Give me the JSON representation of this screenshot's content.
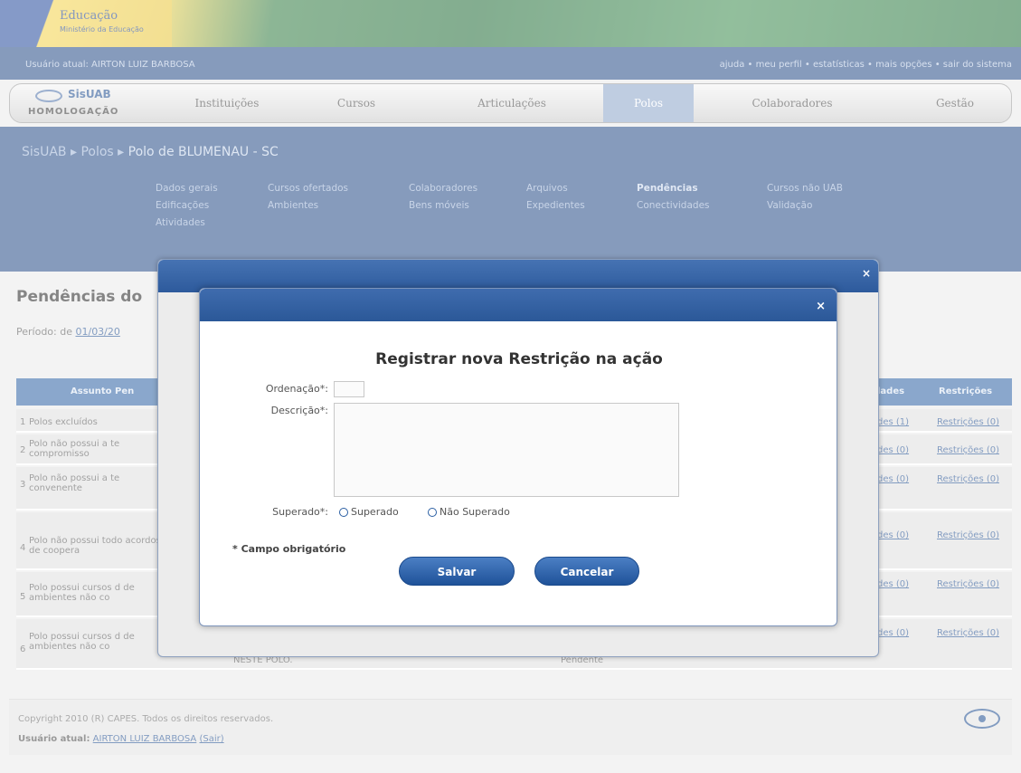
{
  "banner": {
    "title": "Educação",
    "subtitle": "Ministério da Educação"
  },
  "topbar": {
    "user": "Usuário atual: AIRTON LUIZ BARBOSA",
    "links": "ajuda • meu perfil • estatísticas • mais opções • sair do sistema"
  },
  "nav": {
    "brand_top": "SisUAB",
    "brand_bottom": "HOMOLOGAÇÃO",
    "items": [
      "Instituições",
      "Cursos",
      "Articulações",
      "Polos",
      "Colaboradores",
      "Gestão"
    ],
    "active": "Polos"
  },
  "breadcrumb": {
    "root": "SisUAB",
    "section": "Polos",
    "current": "Polo de BLUMENAU - SC",
    "sep": "▸"
  },
  "subnav": {
    "col1": [
      "Dados gerais",
      "Edificações",
      "Atividades"
    ],
    "col2": [
      "Cursos ofertados",
      "Ambientes"
    ],
    "col3": [
      "Colaboradores",
      "Bens móveis"
    ],
    "col4": [
      "Arquivos",
      "Expedientes"
    ],
    "col5": [
      "Pendências",
      "Conectividades"
    ],
    "col6": [
      "Cursos não UAB",
      "Validação"
    ]
  },
  "page": {
    "title": "Pendências do",
    "period_label": "Período: de",
    "period_value": "01/03/20",
    "table": {
      "headers": [
        "Assunto Pen",
        "lades",
        "Restrições"
      ],
      "rows": [
        {
          "n": "1",
          "text": "Polos excluídos",
          "a": "des (1)",
          "b": "Restrições (0)"
        },
        {
          "n": "2",
          "text": "Polo não possui a te compromisso",
          "a": "des (0)",
          "b": "Restrições (0)"
        },
        {
          "n": "3",
          "text": "Polo não possui a te convenente",
          "a": "des (0)",
          "b": "Restrições (0)"
        },
        {
          "n": "4",
          "text": "Polo não possui todo acordos de coopera",
          "a": "des (0)",
          "b": "Restrições (0)"
        },
        {
          "n": "5",
          "text": "Polo possui cursos d de ambientes não co",
          "a": "des (0)",
          "b": "Restrições (0)"
        },
        {
          "n": "6",
          "text": "Polo possui cursos d de ambientes não co",
          "a": "des (0)",
          "b": "Restrições (0)"
        }
      ],
      "under_text_1": "NESTE POLO.",
      "under_text_2": "Pendente"
    }
  },
  "footer": {
    "copyright": "Copyright 2010 (R) CAPES. Todos os direitos reservados.",
    "user_label": "Usuário atual:",
    "user_name": "AIRTON LUIZ BARBOSA",
    "exit": "(Sair)"
  },
  "dialog": {
    "close": "×",
    "title": "Registrar nova Restrição na ação",
    "ordenacao_label": "Ordenação*:",
    "ordenacao_value": "",
    "descricao_label": "Descrição*:",
    "descricao_value": "",
    "superado_label": "Superado*:",
    "option_1": "Superado",
    "option_2": "Não Superado",
    "required_note": "* Campo obrigatório",
    "save": "Salvar",
    "cancel": "Cancelar"
  },
  "colors": {
    "primary": "#234a86",
    "accent": "#2b5fa3",
    "button": "#1f5299"
  }
}
